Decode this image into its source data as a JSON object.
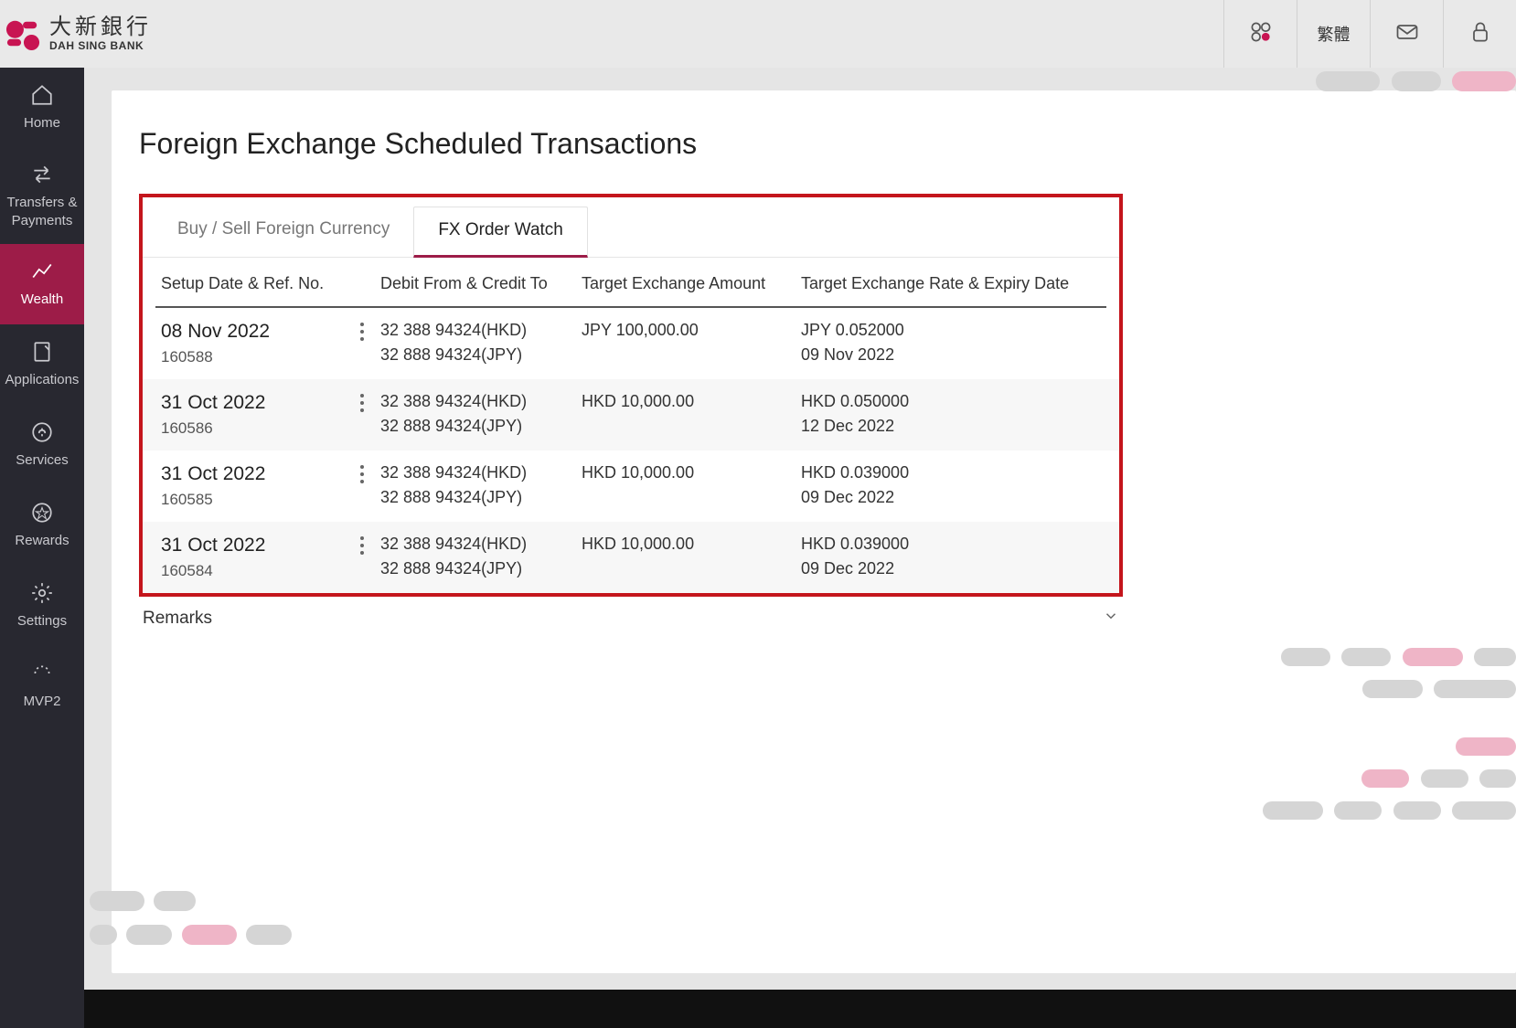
{
  "header": {
    "logo_cn": "大新銀行",
    "logo_en": "DAH SING BANK",
    "lang_label": "繁體"
  },
  "sidebar": {
    "items": [
      {
        "label": "Home"
      },
      {
        "label": "Transfers & Payments"
      },
      {
        "label": "Wealth"
      },
      {
        "label": "Applications"
      },
      {
        "label": "Services"
      },
      {
        "label": "Rewards"
      },
      {
        "label": "Settings"
      },
      {
        "label": "MVP2"
      }
    ]
  },
  "main": {
    "title": "Foreign Exchange Scheduled Transactions",
    "tabs": [
      {
        "label": "Buy / Sell Foreign Currency",
        "active": false
      },
      {
        "label": "FX Order Watch",
        "active": true
      }
    ],
    "columns": {
      "c1": "Setup Date & Ref. No.",
      "c3": "Debit From & Credit To",
      "c4": "Target Exchange Amount",
      "c5": "Target Exchange Rate & Expiry Date"
    },
    "rows": [
      {
        "date": "08 Nov 2022",
        "ref": "160588",
        "debit": "32 388 94324(HKD)",
        "credit": "32 888 94324(JPY)",
        "amount": "JPY 100,000.00",
        "rate": "JPY 0.052000",
        "expiry": "09 Nov 2022"
      },
      {
        "date": "31 Oct 2022",
        "ref": "160586",
        "debit": "32 388 94324(HKD)",
        "credit": "32 888 94324(JPY)",
        "amount": "HKD 10,000.00",
        "rate": "HKD 0.050000",
        "expiry": "12 Dec 2022"
      },
      {
        "date": "31 Oct 2022",
        "ref": "160585",
        "debit": "32 388 94324(HKD)",
        "credit": "32 888 94324(JPY)",
        "amount": "HKD 10,000.00",
        "rate": "HKD 0.039000",
        "expiry": "09 Dec 2022"
      },
      {
        "date": "31 Oct 2022",
        "ref": "160584",
        "debit": "32 388 94324(HKD)",
        "credit": "32 888 94324(JPY)",
        "amount": "HKD 10,000.00",
        "rate": "HKD 0.039000",
        "expiry": "09 Dec 2022"
      }
    ],
    "remarks_label": "Remarks"
  }
}
